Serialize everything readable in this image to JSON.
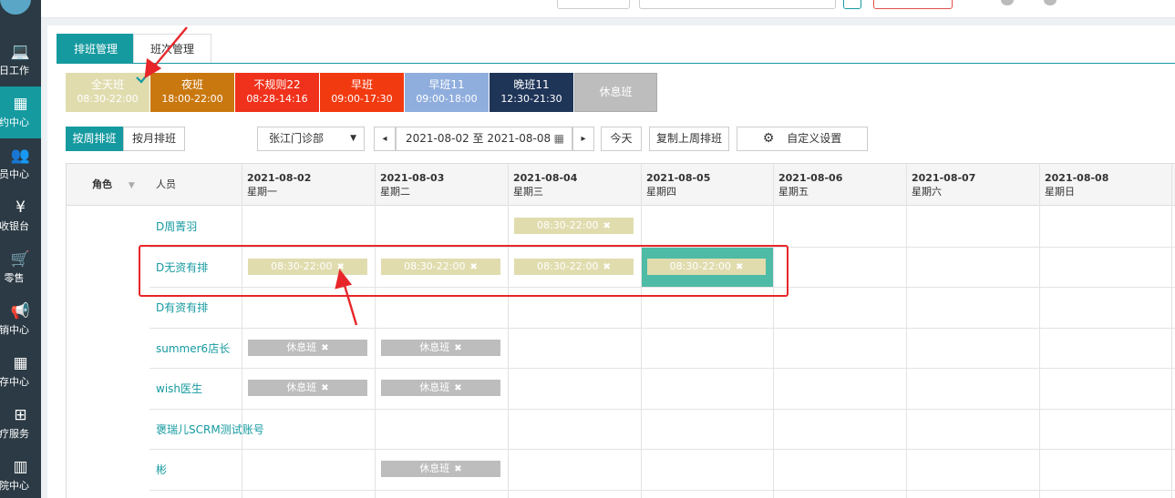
{
  "sidebar": {
    "items": [
      {
        "label": "日工作",
        "icon": "laptop-icon"
      },
      {
        "label": "约中心",
        "icon": "calendar-icon"
      },
      {
        "label": "员中心",
        "icon": "users-icon"
      },
      {
        "label": "收银台",
        "icon": "yen-icon"
      },
      {
        "label": "零售",
        "icon": "cart-icon"
      },
      {
        "label": "销中心",
        "icon": "megaphone-icon"
      },
      {
        "label": "存中心",
        "icon": "grid-icon"
      },
      {
        "label": "疗服务",
        "icon": "medkit-icon"
      },
      {
        "label": "院中心",
        "icon": "building-icon"
      }
    ],
    "glyphs": {
      "laptop": "💻",
      "calendar": "▦",
      "users": "👥",
      "yen": "¥",
      "cart": "🛒",
      "megaphone": "📢",
      "grid": "▦",
      "medkit": "⊞",
      "building": "▥"
    },
    "active_color": "#159aa0"
  },
  "tabs": [
    {
      "label": "排班管理",
      "active": true
    },
    {
      "label": "班次管理",
      "active": false
    }
  ],
  "shifts": [
    {
      "name": "全天班",
      "time": "08:30-22:00",
      "color": "#e0dcae",
      "selected": true
    },
    {
      "name": "夜班",
      "time": "18:00-22:00",
      "color": "#c9780f"
    },
    {
      "name": "不规则22",
      "time": "08:28-14:16",
      "color": "#f0321c"
    },
    {
      "name": "早班",
      "time": "09:00-17:30",
      "color": "#f23a10"
    },
    {
      "name": "早班11",
      "time": "09:00-18:00",
      "color": "#8faedd"
    },
    {
      "name": "晚班11",
      "time": "12:30-21:30",
      "color": "#1f3558"
    },
    {
      "name": "休息班",
      "time": "",
      "color": "#bdbdbd"
    }
  ],
  "toolbar": {
    "week_btn": "按周排班",
    "month_btn": "按月排班",
    "clinic": "张江门诊部",
    "prev": "◂",
    "date_range": "2021-08-02 至 2021-08-08",
    "calendar_glyph": "▦",
    "next": "▸",
    "today": "今天",
    "copy_last_week": "复制上周排班",
    "settings_glyph": "⚙",
    "custom_settings": "自定义设置"
  },
  "table": {
    "role_header": "角色",
    "filter_glyph": "▼",
    "person_header": "人员",
    "days": [
      {
        "date": "2021-08-02",
        "weekday": "星期一"
      },
      {
        "date": "2021-08-03",
        "weekday": "星期二"
      },
      {
        "date": "2021-08-04",
        "weekday": "星期三"
      },
      {
        "date": "2021-08-05",
        "weekday": "星期四"
      },
      {
        "date": "2021-08-06",
        "weekday": "星期五"
      },
      {
        "date": "2021-08-07",
        "weekday": "星期六"
      },
      {
        "date": "2021-08-08",
        "weekday": "星期日"
      }
    ],
    "remove_glyph": "✖",
    "rows": [
      {
        "person": "D周菁羽",
        "cells": [
          "",
          "",
          "08:30-22:00",
          "",
          "",
          "",
          ""
        ]
      },
      {
        "person": "D无资有排",
        "cells": [
          "08:30-22:00",
          "08:30-22:00",
          "08:30-22:00",
          "08:30-22:00",
          "",
          "",
          ""
        ]
      },
      {
        "person": "D有资有排",
        "cells": [
          "",
          "",
          "",
          "",
          "",
          "",
          ""
        ]
      },
      {
        "person": "summer6店长",
        "cells": [
          "休息班",
          "休息班",
          "",
          "",
          "",
          "",
          ""
        ]
      },
      {
        "person": "wish医生",
        "cells": [
          "休息班",
          "休息班",
          "",
          "",
          "",
          "",
          ""
        ]
      },
      {
        "person": "褒瑞儿SCRM测试账号",
        "cells": [
          "",
          "",
          "",
          "",
          "",
          "",
          ""
        ]
      },
      {
        "person": "彬",
        "cells": [
          "",
          "休息班",
          "",
          "",
          "",
          "",
          ""
        ]
      }
    ],
    "selected_cell": {
      "row": 1,
      "col": 3,
      "color": "#4dbba6"
    }
  },
  "annotation_color": "#e8262a"
}
